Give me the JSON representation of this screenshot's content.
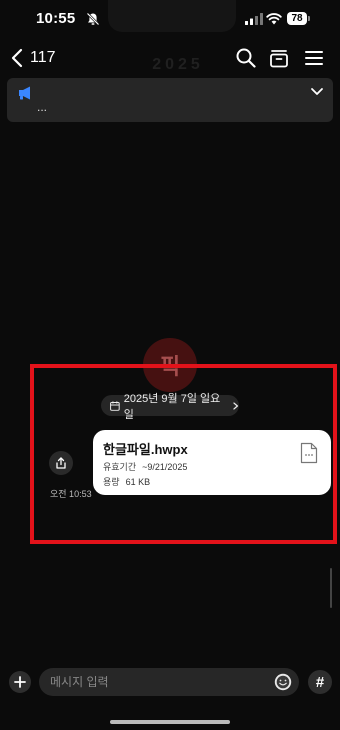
{
  "status_bar": {
    "time": "10:55",
    "battery": "78"
  },
  "header": {
    "member_count": "117"
  },
  "watermark": "2025",
  "notice": {
    "text": "..."
  },
  "stamp": "픽",
  "date_chip": {
    "label": "2025년 9월 7일 일요일"
  },
  "message": {
    "time": "오전 10:53",
    "file_name": "한글파일.hwpx",
    "expiry_label": "유효기간",
    "expiry_value": "~9/21/2025",
    "size_label": "용량",
    "size_value": "61 KB"
  },
  "input": {
    "placeholder": "메시지 입력",
    "hashtag": "#"
  },
  "colors": {
    "background": "#0b0b0b",
    "highlight": "#e3121a",
    "notice_icon": "#3a86ff",
    "bubble": "#ffffff"
  }
}
